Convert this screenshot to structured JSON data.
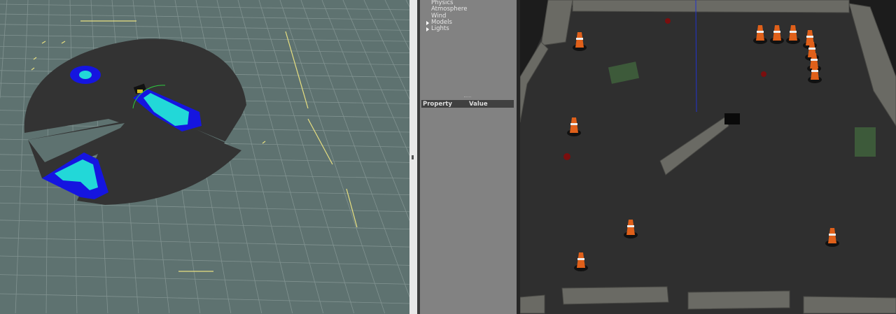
{
  "world_panel": {
    "tree_items": [
      {
        "label": "Physics",
        "expandable": false
      },
      {
        "label": "Atmosphere",
        "expandable": false
      },
      {
        "label": "Wind",
        "expandable": false
      },
      {
        "label": "Models",
        "expandable": true
      },
      {
        "label": "Lights",
        "expandable": true
      }
    ],
    "property_header": "Property",
    "value_header": "Value"
  },
  "colors": {
    "rviz_background": "#5e7270",
    "map_free": "#343434",
    "costmap_inflation": "#1515e0",
    "costmap_lethal": "#22d8d8",
    "gazebo_floor": "#2f2f2f"
  }
}
